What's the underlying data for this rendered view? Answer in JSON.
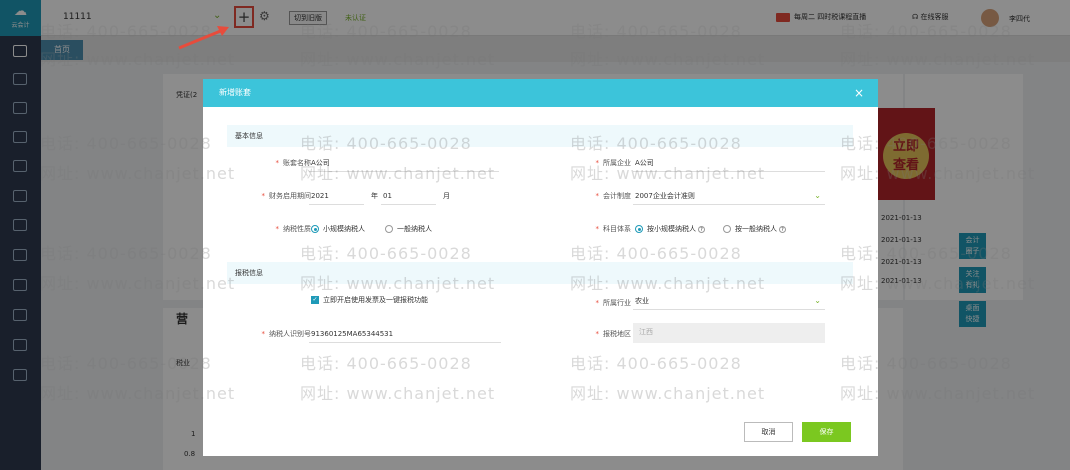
{
  "app": {
    "logo_text": "云会计",
    "account_name": "11111",
    "switch_label": "切到旧版",
    "cert_status": "未认证"
  },
  "header": {
    "live_text": "每周二 四时税课程直播",
    "service_text": "在线客服",
    "user_name": "李四代"
  },
  "tabs": [
    {
      "label": "首页"
    }
  ],
  "background": {
    "voucher_label": "凭证(2",
    "dates": [
      "2021-01-13",
      "2021-01-13",
      "2021-01-13",
      "2021-01-13"
    ],
    "promo_line1": "立即",
    "promo_line2": "查看",
    "float_buttons": [
      {
        "l1": "会计",
        "l2": "圈子"
      },
      {
        "l1": "关注",
        "l2": "有礼"
      },
      {
        "l1": "桌面",
        "l2": "快捷"
      }
    ],
    "chart_title_frag": "营",
    "row_frag": "税业",
    "axis_1": "1",
    "axis_08": "0.8"
  },
  "watermark": {
    "phone": "电话: 400-665-0028",
    "site": "网址: www.chanjet.net"
  },
  "dialog": {
    "title": "新增账套",
    "close_icon": "×",
    "section_basic": "基本信息",
    "section_tax": "报税信息",
    "labels": {
      "book_name": "账套名称",
      "company": "所属企业",
      "period": "财务启用期间",
      "standard": "会计制度",
      "taxpayer": "纳税性质",
      "subject": "科目体系",
      "industry": "所属行业",
      "tax_id": "纳税人识别号",
      "region": "报税地区"
    },
    "values": {
      "book_name": "A公司",
      "company": "A公司",
      "year": "2021",
      "year_unit": "年",
      "month": "01",
      "month_unit": "月",
      "standard": "2007企业会计准则",
      "taxpayer_small": "小规模纳税人",
      "taxpayer_general": "一般纳税人",
      "subject_small": "按小规模纳税人",
      "subject_general": "按一般纳税人",
      "invoice_check": "立即开启使用发票及一键报税功能",
      "industry": "农业",
      "tax_id": "91360125MA65344531",
      "region": "江西"
    },
    "cancel_label": "取消",
    "save_label": "保存"
  },
  "colors": {
    "accent": "#3cc4da",
    "sidebar": "#2f3a4f",
    "save": "#7bc820",
    "required": "#e74c3c"
  }
}
